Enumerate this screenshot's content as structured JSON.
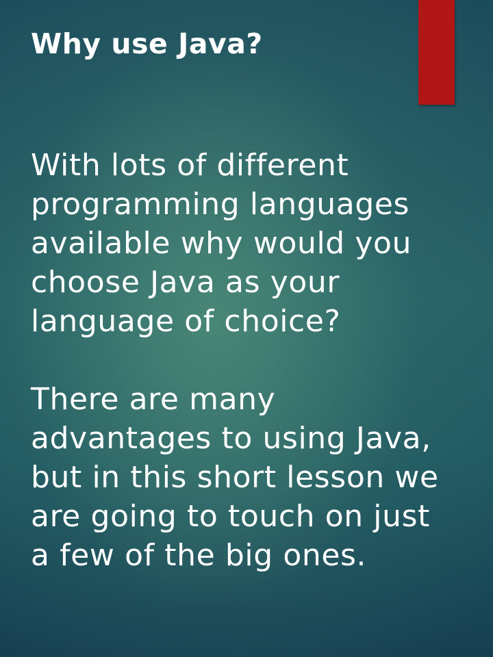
{
  "slide": {
    "title": "Why use Java?",
    "paragraphs": [
      "With lots of different\nprogramming languages\navailable why would you\nchoose Java as your\nlanguage of choice?",
      "There are many\nadvantages to using Java,\nbut in this short lesson we\nare going to touch on just\na few of the big ones."
    ]
  },
  "colors": {
    "accent_bar": "#b01616",
    "background": "#255f66",
    "text": "#ffffff"
  }
}
